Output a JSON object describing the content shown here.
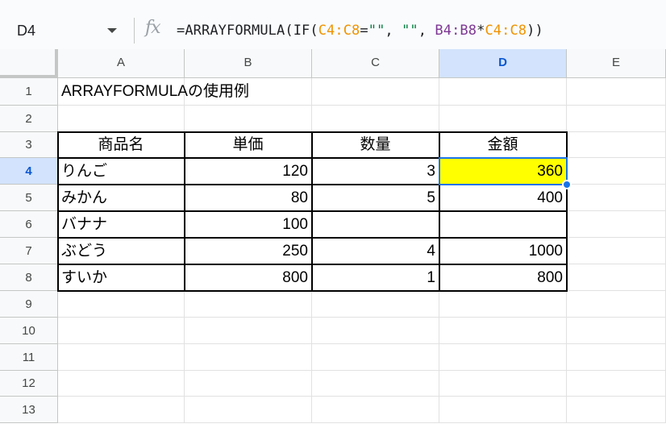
{
  "name_box": {
    "value": "D4"
  },
  "formula_bar": {
    "fx_label": "fx",
    "tokens": [
      {
        "text": "=ARRAYFORMULA(IF(",
        "color": "default"
      },
      {
        "text": "C4:C8",
        "color": "orange"
      },
      {
        "text": "=",
        "color": "default"
      },
      {
        "text": "\"\"",
        "color": "green"
      },
      {
        "text": ", ",
        "color": "default"
      },
      {
        "text": "\"\"",
        "color": "green"
      },
      {
        "text": ", ",
        "color": "default"
      },
      {
        "text": "B4:B8",
        "color": "purple"
      },
      {
        "text": "*",
        "color": "default"
      },
      {
        "text": "C4:C8",
        "color": "orange"
      },
      {
        "text": "))",
        "color": "default"
      }
    ]
  },
  "colors": {
    "selection": "#1a73e8",
    "highlight_fill": "#ffff00",
    "header_active": "#d3e3fd",
    "ref_orange": "#f09300",
    "ref_purple": "#7e3794",
    "string_green": "#0b8043"
  },
  "columns": [
    "A",
    "B",
    "C",
    "D",
    "E"
  ],
  "rows": [
    "1",
    "2",
    "3",
    "4",
    "5",
    "6",
    "7",
    "8",
    "9",
    "10",
    "11",
    "12",
    "13"
  ],
  "active_cell": {
    "column": "D",
    "row": "4"
  },
  "sheet": {
    "title": "ARRAYFORMULAの使用例",
    "headers": [
      "商品名",
      "単価",
      "数量",
      "金額"
    ],
    "rows": [
      {
        "name": "りんご",
        "price": "120",
        "qty": "3",
        "amount": "360"
      },
      {
        "name": "みかん",
        "price": "80",
        "qty": "5",
        "amount": "400"
      },
      {
        "name": "バナナ",
        "price": "100",
        "qty": "",
        "amount": ""
      },
      {
        "name": "ぶどう",
        "price": "250",
        "qty": "4",
        "amount": "1000"
      },
      {
        "name": "すいか",
        "price": "800",
        "qty": "1",
        "amount": "800"
      }
    ]
  }
}
